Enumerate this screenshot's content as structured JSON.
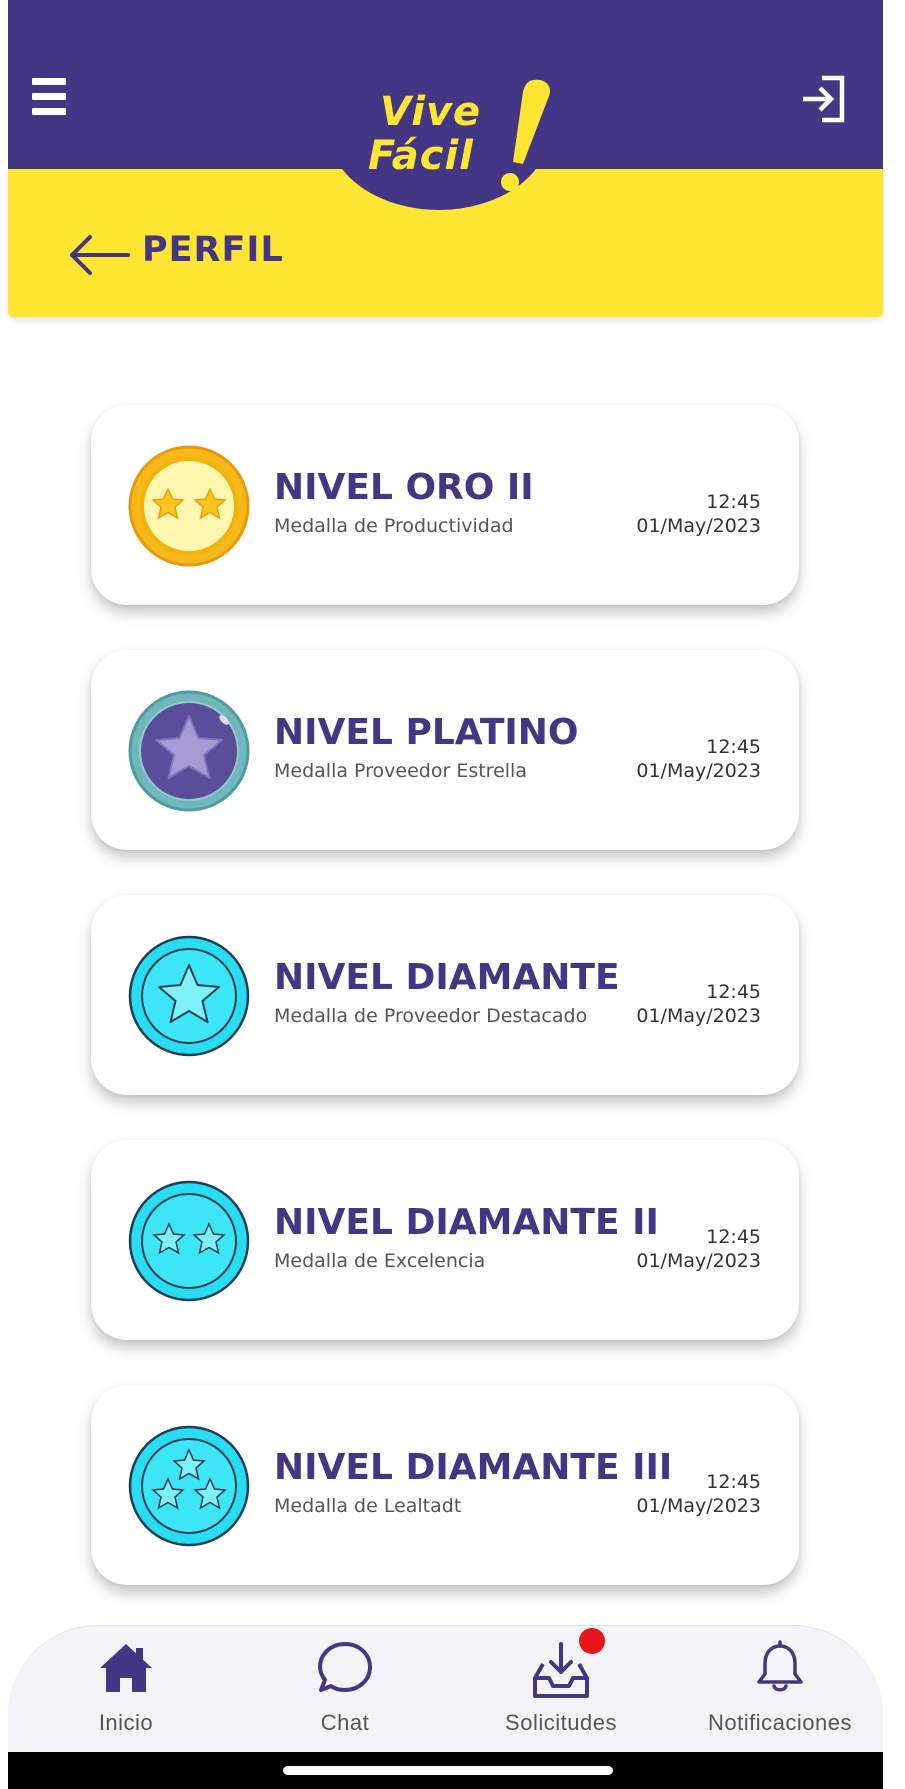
{
  "header": {
    "logo_line1": "Vive",
    "logo_line2": "Fácil",
    "page_title": "PERFIL",
    "icons": {
      "menu": "hamburger-menu-icon",
      "logout": "login-exit-icon",
      "back": "back-arrow-icon"
    }
  },
  "colors": {
    "primary": "#433684",
    "accent": "#FFE632",
    "badge": "#E8161C"
  },
  "medals": [
    {
      "title": "NIVEL ORO II",
      "subtitle": "Medalla de Productividad",
      "time": "12:45",
      "date": "01/May/2023",
      "medal": "gold-two-stars"
    },
    {
      "title": "NIVEL PLATINO",
      "subtitle": "Medalla Proveedor Estrella",
      "time": "12:45",
      "date": "01/May/2023",
      "medal": "platinum-star"
    },
    {
      "title": "NIVEL DIAMANTE",
      "subtitle": "Medalla de Proveedor Destacado",
      "time": "12:45",
      "date": "01/May/2023",
      "medal": "diamond-one-star"
    },
    {
      "title": "NIVEL DIAMANTE II",
      "subtitle": "Medalla de Excelencia",
      "time": "12:45",
      "date": "01/May/2023",
      "medal": "diamond-two-stars"
    },
    {
      "title": "NIVEL DIAMANTE III",
      "subtitle": "Medalla de Lealtadt",
      "time": "12:45",
      "date": "01/May/2023",
      "medal": "diamond-three-stars"
    }
  ],
  "nav": [
    {
      "label": "Inicio",
      "icon": "home-icon"
    },
    {
      "label": "Chat",
      "icon": "chat-icon"
    },
    {
      "label": "Solicitudes",
      "icon": "inbox-download-icon"
    },
    {
      "label": "Notificaciones",
      "icon": "bell-icon"
    }
  ]
}
